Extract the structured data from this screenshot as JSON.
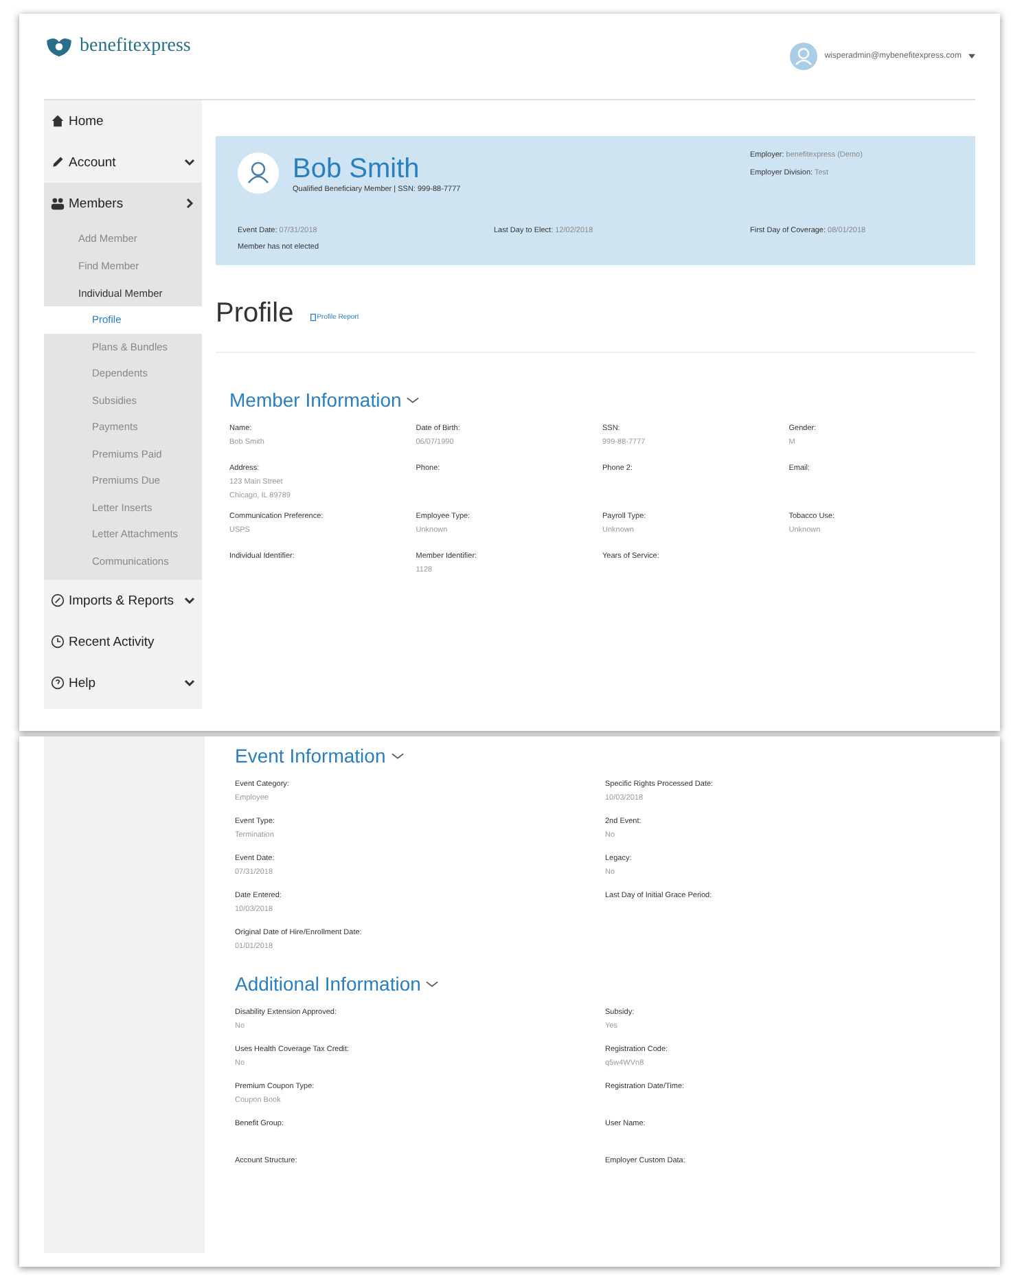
{
  "header": {
    "logo": "benefitexpress",
    "user_email": "wisperadmin@mybenefitexpress.com"
  },
  "sidebar": {
    "items": [
      {
        "label": "Home",
        "selected": false
      },
      {
        "label": "Account",
        "selected": false
      },
      {
        "label": "Members",
        "selected": true,
        "children": [
          {
            "label": "Add Member",
            "selected": false
          },
          {
            "label": "Find Member",
            "selected": false
          },
          {
            "label": "Individual Member",
            "selected": true,
            "children": [
              {
                "label": "Profile",
                "selected": true
              },
              {
                "label": "Plans & Bundles",
                "selected": false
              },
              {
                "label": "Dependents",
                "selected": false
              },
              {
                "label": "Subsidies",
                "selected": false
              },
              {
                "label": "Payments",
                "selected": false
              },
              {
                "label": "Premiums Paid",
                "selected": false
              },
              {
                "label": "Premiums Due",
                "selected": false
              },
              {
                "label": "Letter Inserts",
                "selected": false
              },
              {
                "label": "Letter Attachments",
                "selected": false
              },
              {
                "label": "Communications",
                "selected": false
              }
            ]
          }
        ]
      },
      {
        "label": "Imports & Reports",
        "selected": false
      },
      {
        "label": "Recent Activity",
        "selected": false
      },
      {
        "label": "Help",
        "selected": false
      }
    ]
  },
  "banner": {
    "name": "Bob Smith",
    "subtitle": "Qualified Beneficiary Member | SSN: 999-88-7777",
    "employer": [
      {
        "label": "Employer:",
        "value": "benefitexpress (Demo)"
      },
      {
        "label": "Employer Division:",
        "value": "Test"
      }
    ],
    "dates": [
      {
        "label": "Event Date:",
        "value": "07/31/2018"
      },
      {
        "label": "Last Day to Elect:",
        "value": "12/02/2018"
      },
      {
        "label": "First Day of Coverage:",
        "value": "08/01/2018"
      }
    ],
    "status": "Member has not elected"
  },
  "page_title": "Profile",
  "report_link": "Profile Report",
  "sections": [
    {
      "title": "Member Information",
      "fields": [
        {
          "label": "Name:",
          "value": [
            "Bob Smith"
          ]
        },
        {
          "label": "Date of Birth:",
          "value": [
            "06/07/1990"
          ]
        },
        {
          "label": "SSN:",
          "value": [
            "999-88-7777"
          ]
        },
        {
          "label": "Gender:",
          "value": [
            "M"
          ]
        },
        {
          "label": "Address:",
          "value": [
            "123 Main Street",
            "Chicago, IL 89789"
          ]
        },
        {
          "label": "Phone:"
        },
        {
          "label": "Phone 2:"
        },
        {
          "label": "Email:"
        },
        {
          "label": "Communication Preference:",
          "value": [
            "USPS"
          ]
        },
        {
          "label": "Employee Type:",
          "value": [
            "Unknown"
          ]
        },
        {
          "label": "Payroll Type:",
          "value": [
            "Unknown"
          ]
        },
        {
          "label": "Tobacco Use:",
          "value": [
            "Unknown"
          ]
        },
        {
          "label": "Individual Identifier:"
        },
        {
          "label": "Member Identifier:",
          "value": [
            "1128"
          ]
        },
        {
          "label": "Years of Service:"
        }
      ]
    },
    {
      "title": "Event Information",
      "fields": [
        {
          "label": "Event Category:",
          "value": [
            "Employee"
          ]
        },
        {
          "label": "Specific Rights Processed Date:",
          "value": [
            "10/03/2018"
          ]
        },
        {
          "label": "Event Type:",
          "value": [
            "Termination"
          ]
        },
        {
          "label": "2nd Event:",
          "value": [
            "No"
          ]
        },
        {
          "label": "Event Date:",
          "value": [
            "07/31/2018"
          ]
        },
        {
          "label": "Legacy:",
          "value": [
            "No"
          ]
        },
        {
          "label": "Date Entered:",
          "value": [
            "10/03/2018"
          ]
        },
        {
          "label": "Last Day of Initial Grace Period:"
        },
        {
          "label": "Original Date of Hire/Enrollment Date:",
          "value": [
            "01/01/2018"
          ]
        }
      ]
    },
    {
      "title": "Additional Information",
      "fields": [
        {
          "label": "Disability Extension Approved:",
          "value": [
            "No"
          ]
        },
        {
          "label": "Subsidy:",
          "value": [
            "Yes"
          ]
        },
        {
          "label": "Uses Health Coverage Tax Credit:",
          "value": [
            "No"
          ]
        },
        {
          "label": "Registration Code:",
          "value": [
            "q5w4WVn8"
          ]
        },
        {
          "label": "Premium Coupon Type:",
          "value": [
            "Coupon Book"
          ]
        },
        {
          "label": "Registration Date/Time:"
        },
        {
          "label": "Benefit Group:"
        },
        {
          "label": "User Name:"
        },
        {
          "label": "Account Structure:"
        },
        {
          "label": "Employer Custom Data:"
        }
      ]
    }
  ]
}
